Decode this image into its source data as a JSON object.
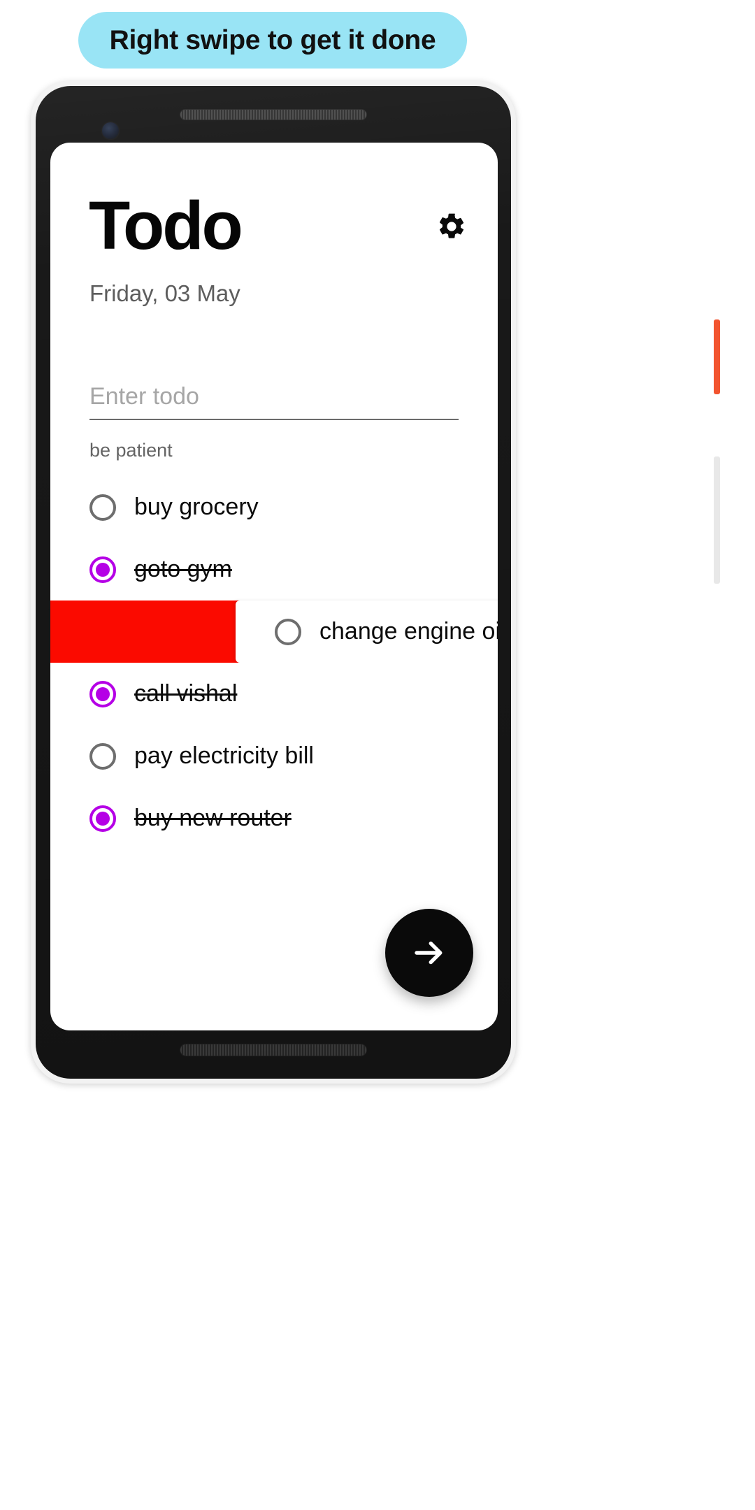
{
  "caption": {
    "text": "Right swipe to get it done",
    "background_color": "#99e4f5",
    "text_color": "#111111"
  },
  "device": {
    "frame_color": "#f2f2f2",
    "body_color": "#191919",
    "power_button_color": "#f2542f",
    "volume_button_color": "#e8e8e8",
    "icons": {
      "earpiece": "speaker-grille-icon",
      "front_camera": "front-camera-icon",
      "bottom_speaker": "speaker-grille-icon"
    }
  },
  "app": {
    "title": "Todo",
    "date": "Friday, 03 May",
    "settings_icon": "gear-icon",
    "input": {
      "placeholder": "Enter todo",
      "value": ""
    },
    "helper_text": "be patient",
    "fab": {
      "icon": "arrow-right-icon",
      "background_color": "#0a0a0a",
      "icon_color": "#ffffff"
    },
    "accent_done_color": "#b500e6",
    "swipe_action_color": "#fb0a00",
    "items": [
      {
        "label": "buy grocery",
        "done": false,
        "swiping": false
      },
      {
        "label": "goto gym",
        "done": true,
        "swiping": false
      },
      {
        "label": "change engine oil",
        "done": false,
        "swiping": true
      },
      {
        "label": "call vishal",
        "done": true,
        "swiping": false
      },
      {
        "label": "pay electricity bill",
        "done": false,
        "swiping": false
      },
      {
        "label": "buy new router",
        "done": true,
        "swiping": false
      }
    ]
  }
}
